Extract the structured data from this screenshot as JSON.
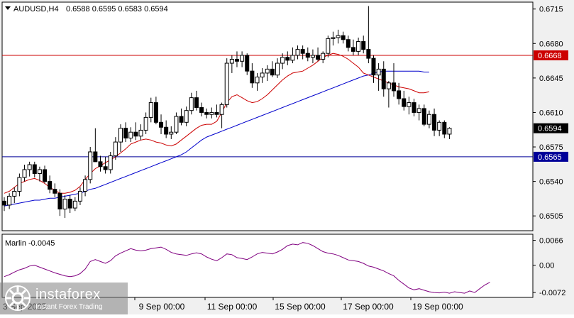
{
  "header": {
    "symbol_label": "AUDUSD,H4",
    "ohlc": "0.6588 0.6595 0.6583 0.6594"
  },
  "indicator": {
    "label": "Marlin -0.0045"
  },
  "watermark": {
    "brand": "instaforex",
    "tagline": "Instant Forex Trading"
  },
  "colors": {
    "chart_bg": "#ffffff",
    "frame_bg": "#f0f0f0",
    "bull_candle": "#ffffff",
    "bear_candle": "#000000",
    "red_ma": "#cc0000",
    "blue_ma": "#0000cc",
    "resistance_line": "#cc0000",
    "support_line": "#000099",
    "marlin_line": "#800080",
    "price_tag_resistance": "#cc0000",
    "price_tag_support": "#000099"
  },
  "chart_data": [
    {
      "type": "candlestick",
      "title": "AUDUSD,H4",
      "y_ticks": [
        "0.6715",
        "0.6680",
        "0.6645",
        "0.6610",
        "0.6575",
        "0.6540",
        "0.6505"
      ],
      "ylim": [
        0.649,
        0.6722
      ],
      "x_ticks": [
        "9 Sep 00:00",
        "11 Sep 00:00",
        "15 Sep 00:00",
        "17 Sep 00:00",
        "19 Sep 00:00"
      ],
      "x_partial_tick": "3 Sep 2025",
      "current_price": "0.6594",
      "horizontal_levels": [
        {
          "label": "0.6668",
          "value": 0.6668,
          "color": "resistance"
        },
        {
          "label": "0.6565",
          "value": 0.6565,
          "color": "support"
        }
      ],
      "candles": [
        [
          0.652,
          0.6524,
          0.651,
          0.6516
        ],
        [
          0.6516,
          0.6528,
          0.6512,
          0.6525
        ],
        [
          0.6525,
          0.6534,
          0.6518,
          0.653
        ],
        [
          0.653,
          0.6548,
          0.6525,
          0.6544
        ],
        [
          0.6544,
          0.6557,
          0.654,
          0.6552
        ],
        [
          0.6552,
          0.656,
          0.6545,
          0.6557
        ],
        [
          0.6557,
          0.656,
          0.6544,
          0.6548
        ],
        [
          0.6548,
          0.6555,
          0.654,
          0.6552
        ],
        [
          0.6552,
          0.6556,
          0.6538,
          0.654
        ],
        [
          0.654,
          0.6546,
          0.6528,
          0.6532
        ],
        [
          0.6532,
          0.6538,
          0.6524,
          0.6528
        ],
        [
          0.6528,
          0.6532,
          0.6505,
          0.6512
        ],
        [
          0.6512,
          0.6526,
          0.6503,
          0.6522
        ],
        [
          0.6522,
          0.6526,
          0.6508,
          0.6513
        ],
        [
          0.6513,
          0.6524,
          0.651,
          0.652
        ],
        [
          0.652,
          0.6534,
          0.6516,
          0.653
        ],
        [
          0.653,
          0.6546,
          0.6525,
          0.6542
        ],
        [
          0.6542,
          0.6575,
          0.6538,
          0.657
        ],
        [
          0.657,
          0.6594,
          0.656,
          0.656
        ],
        [
          0.656,
          0.6566,
          0.655,
          0.6555
        ],
        [
          0.6555,
          0.6565,
          0.6548,
          0.6552
        ],
        [
          0.6552,
          0.657,
          0.6548,
          0.6566
        ],
        [
          0.6566,
          0.6585,
          0.6562,
          0.658
        ],
        [
          0.658,
          0.6598,
          0.657,
          0.6594
        ],
        [
          0.6594,
          0.66,
          0.658,
          0.6584
        ],
        [
          0.6584,
          0.6595,
          0.658,
          0.659
        ],
        [
          0.659,
          0.66,
          0.6582,
          0.6586
        ],
        [
          0.6586,
          0.6598,
          0.6582,
          0.6592
        ],
        [
          0.6592,
          0.661,
          0.6588,
          0.6605
        ],
        [
          0.6605,
          0.6625,
          0.66,
          0.662
        ],
        [
          0.662,
          0.6626,
          0.6598,
          0.66
        ],
        [
          0.66,
          0.6608,
          0.6588,
          0.6595
        ],
        [
          0.6595,
          0.6602,
          0.6584,
          0.6588
        ],
        [
          0.6588,
          0.6596,
          0.6583,
          0.659
        ],
        [
          0.659,
          0.661,
          0.6588,
          0.6606
        ],
        [
          0.6606,
          0.6614,
          0.6597,
          0.66
        ],
        [
          0.66,
          0.6616,
          0.6596,
          0.6612
        ],
        [
          0.6612,
          0.663,
          0.6608,
          0.6625
        ],
        [
          0.6625,
          0.6632,
          0.6612,
          0.6615
        ],
        [
          0.6615,
          0.662,
          0.6606,
          0.661
        ],
        [
          0.661,
          0.6614,
          0.6604,
          0.6608
        ],
        [
          0.6608,
          0.6615,
          0.6604,
          0.661
        ],
        [
          0.661,
          0.6618,
          0.6605,
          0.6608
        ],
        [
          0.6608,
          0.662,
          0.6594,
          0.6618
        ],
        [
          0.6618,
          0.6665,
          0.6615,
          0.666
        ],
        [
          0.666,
          0.6668,
          0.665,
          0.6664
        ],
        [
          0.6664,
          0.6672,
          0.6656,
          0.6662
        ],
        [
          0.6662,
          0.6672,
          0.6656,
          0.6668
        ],
        [
          0.6668,
          0.667,
          0.6648,
          0.6652
        ],
        [
          0.6652,
          0.666,
          0.6635,
          0.664
        ],
        [
          0.664,
          0.665,
          0.6632,
          0.6646
        ],
        [
          0.6646,
          0.6655,
          0.664,
          0.665
        ],
        [
          0.665,
          0.6658,
          0.6642,
          0.6654
        ],
        [
          0.6654,
          0.6662,
          0.6646,
          0.6648
        ],
        [
          0.6648,
          0.6665,
          0.6645,
          0.666
        ],
        [
          0.666,
          0.667,
          0.6654,
          0.6666
        ],
        [
          0.6666,
          0.6672,
          0.6658,
          0.6663
        ],
        [
          0.6663,
          0.6676,
          0.666,
          0.6668
        ],
        [
          0.6668,
          0.6678,
          0.6664,
          0.6674
        ],
        [
          0.6674,
          0.6678,
          0.6664,
          0.667
        ],
        [
          0.667,
          0.6676,
          0.6662,
          0.6666
        ],
        [
          0.6666,
          0.6674,
          0.666,
          0.6668
        ],
        [
          0.6668,
          0.6676,
          0.6662,
          0.6664
        ],
        [
          0.6664,
          0.6672,
          0.666,
          0.667
        ],
        [
          0.667,
          0.6688,
          0.6666,
          0.6685
        ],
        [
          0.6685,
          0.6692,
          0.6678,
          0.6686
        ],
        [
          0.6686,
          0.6694,
          0.668,
          0.6688
        ],
        [
          0.6688,
          0.6692,
          0.668,
          0.6684
        ],
        [
          0.6684,
          0.6688,
          0.6672,
          0.6676
        ],
        [
          0.6676,
          0.6684,
          0.6668,
          0.6672
        ],
        [
          0.6672,
          0.6686,
          0.6668,
          0.6682
        ],
        [
          0.6682,
          0.6688,
          0.667,
          0.6674
        ],
        [
          0.6674,
          0.6718,
          0.666,
          0.6665
        ],
        [
          0.6665,
          0.6668,
          0.664,
          0.6648
        ],
        [
          0.6648,
          0.666,
          0.6632,
          0.6654
        ],
        [
          0.6654,
          0.6662,
          0.6626,
          0.6634
        ],
        [
          0.6634,
          0.6642,
          0.6615,
          0.664
        ],
        [
          0.664,
          0.666,
          0.6626,
          0.6632
        ],
        [
          0.6632,
          0.664,
          0.6618,
          0.6624
        ],
        [
          0.6624,
          0.6632,
          0.6612,
          0.6616
        ],
        [
          0.6616,
          0.6626,
          0.6608,
          0.662
        ],
        [
          0.662,
          0.6624,
          0.6606,
          0.661
        ],
        [
          0.661,
          0.6618,
          0.6602,
          0.6614
        ],
        [
          0.6614,
          0.6618,
          0.6596,
          0.6598
        ],
        [
          0.6598,
          0.6612,
          0.6594,
          0.6608
        ],
        [
          0.6608,
          0.6614,
          0.6586,
          0.6592
        ],
        [
          0.6592,
          0.6602,
          0.6586,
          0.66
        ],
        [
          0.66,
          0.6602,
          0.6584,
          0.6588
        ],
        [
          0.6588,
          0.6595,
          0.6583,
          0.6594
        ]
      ],
      "red_ma": [
        0.6528,
        0.653,
        0.6534,
        0.6538,
        0.654,
        0.6542,
        0.6543,
        0.6541,
        0.6538,
        0.6534,
        0.6531,
        0.6528,
        0.6528,
        0.6529,
        0.6531,
        0.6535,
        0.6542,
        0.6548,
        0.6553,
        0.6556,
        0.6559,
        0.6562,
        0.6565,
        0.6569,
        0.6573,
        0.6578,
        0.658,
        0.6582,
        0.6583,
        0.6582,
        0.658,
        0.6579,
        0.6577,
        0.6576,
        0.6578,
        0.6582,
        0.6586,
        0.659,
        0.6594,
        0.6597,
        0.6598,
        0.6598,
        0.6601,
        0.661,
        0.662,
        0.6626,
        0.6628,
        0.6625,
        0.6622,
        0.662,
        0.6621,
        0.6624,
        0.6628,
        0.6633,
        0.6638,
        0.6643,
        0.6647,
        0.665,
        0.6651,
        0.6652,
        0.6655,
        0.6658,
        0.6662,
        0.6666,
        0.6668,
        0.667,
        0.6669,
        0.6667,
        0.6664,
        0.666,
        0.6656,
        0.665,
        0.6648,
        0.6646,
        0.6644,
        0.6642,
        0.664,
        0.6638,
        0.6636,
        0.6635,
        0.6634,
        0.6632,
        0.663,
        0.663,
        0.6631
      ],
      "red_ma_start": 0,
      "blue_ma": [
        0.6515,
        0.6516,
        0.6517,
        0.6518,
        0.6519,
        0.652,
        0.6521,
        0.6521,
        0.6522,
        0.6523,
        0.6523,
        0.6524,
        0.6525,
        0.6526,
        0.6527,
        0.6528,
        0.653,
        0.6532,
        0.6533,
        0.6535,
        0.6537,
        0.6539,
        0.6541,
        0.6543,
        0.6545,
        0.6547,
        0.6549,
        0.6551,
        0.6553,
        0.6555,
        0.6557,
        0.6559,
        0.6561,
        0.6563,
        0.6565,
        0.6567,
        0.657,
        0.6574,
        0.6578,
        0.6582,
        0.6585,
        0.6587,
        0.6589,
        0.6591,
        0.6593,
        0.6595,
        0.6597,
        0.6599,
        0.6601,
        0.6603,
        0.6605,
        0.6607,
        0.6609,
        0.6611,
        0.6613,
        0.6615,
        0.6617,
        0.6619,
        0.6621,
        0.6623,
        0.6625,
        0.6627,
        0.6629,
        0.6631,
        0.6633,
        0.6635,
        0.6637,
        0.6639,
        0.6641,
        0.6643,
        0.6645,
        0.6647,
        0.6648,
        0.665,
        0.6651,
        0.6652,
        0.6652,
        0.6652,
        0.6652,
        0.6652,
        0.6652,
        0.6652,
        0.6652,
        0.6651,
        0.6651
      ],
      "blue_ma_start": 0
    },
    {
      "type": "line",
      "title": "Marlin -0.0045",
      "y_ticks": [
        "0.0066",
        "0.00",
        "-0.0072"
      ],
      "ylim": [
        -0.0085,
        0.0082
      ],
      "values": [
        -0.003,
        -0.0025,
        -0.0018,
        -0.0012,
        -0.0008,
        -0.0002,
        0.0,
        -0.0005,
        -0.001,
        -0.0015,
        -0.002,
        -0.0024,
        -0.0028,
        -0.003,
        -0.0028,
        -0.0022,
        -0.001,
        0.001,
        0.0015,
        0.001,
        0.0005,
        0.0012,
        0.0025,
        0.0032,
        0.0038,
        0.0044,
        0.004,
        0.0038,
        0.004,
        0.0044,
        0.0046,
        0.0048,
        0.0042,
        0.0034,
        0.003,
        0.0028,
        0.0026,
        0.003,
        0.0033,
        0.003,
        0.0022,
        0.0016,
        0.0012,
        0.002,
        0.003,
        0.0028,
        0.002,
        0.0018,
        0.0015,
        0.0022,
        0.003,
        0.0034,
        0.0032,
        0.003,
        0.0035,
        0.0042,
        0.0052,
        0.0056,
        0.0054,
        0.006,
        0.0058,
        0.0052,
        0.0044,
        0.0036,
        0.0032,
        0.003,
        0.0026,
        0.002,
        0.0014,
        0.0012,
        0.001,
        0.0005,
        -0.0002,
        -0.0005,
        -0.001,
        -0.0015,
        -0.0022,
        -0.0028,
        -0.004,
        -0.005,
        -0.006,
        -0.0065,
        -0.0062,
        -0.0066,
        -0.007,
        -0.0072,
        -0.0073,
        -0.0071,
        -0.0074,
        -0.007,
        -0.0072,
        -0.0074,
        -0.0068,
        -0.0072,
        -0.0062,
        -0.0052,
        -0.0045
      ]
    }
  ]
}
